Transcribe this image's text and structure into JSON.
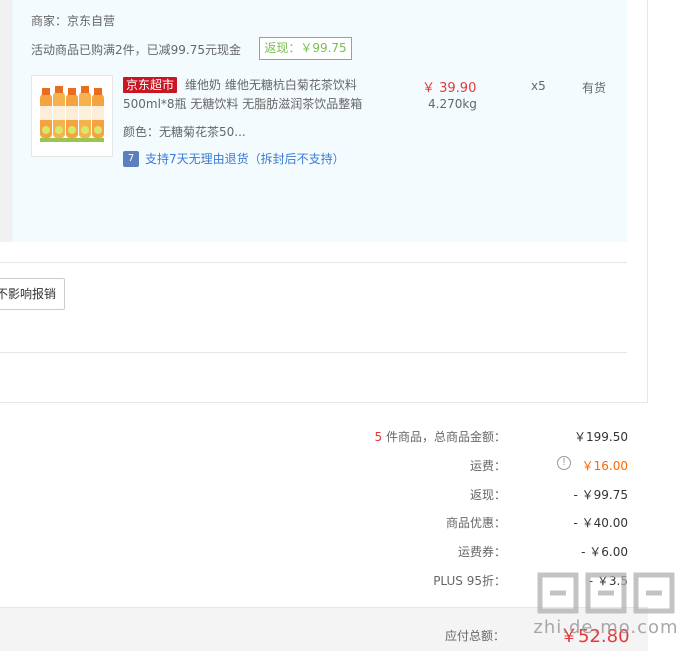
{
  "shop": {
    "seller": "商家：京东自营",
    "promo": "活动商品已购满2件，已减99.75元现金",
    "cashback_tag": "返现：￥99.75"
  },
  "item": {
    "tag": "京东超市",
    "title": "维他奶 维他无糖杭白菊花茶饮料500ml*8瓶 无糖饮料 无脂肪滋润茶饮品整箱",
    "color": "颜色：无糖菊花茶50...",
    "return_icon": "7",
    "return_text": "支持7天无理由退货（拆封后不支持）",
    "price": "￥ 39.90",
    "weight": "4.270kg",
    "qty": "x5",
    "stock": "有货",
    "thumb_icon": "product-bottles-icon"
  },
  "invoice_button": "不影响报销",
  "summary": {
    "count": "5",
    "count_label": " 件商品，总商品金额：",
    "total_value": "￥199.50",
    "shipping_label": "运费：",
    "shipping_info_icon": "!",
    "shipping_value": "￥16.00",
    "cashback_label": "返现：",
    "cashback_value": "- ￥99.75",
    "discount_label": "商品优惠：",
    "discount_value": "- ￥40.00",
    "coupon_label": "运费券：",
    "coupon_value": "- ￥6.00",
    "plus_label": "PLUS 95折：",
    "plus_value": "- ￥3.5",
    "pay_label": "应付总额：",
    "pay_value": "￥52.80"
  },
  "watermark": {
    "glyph": "值",
    "text": "zhi.de.mo.com"
  },
  "colors": {
    "accent_red": "#e4393c",
    "shipping_orange": "#ff6600",
    "cashback_green": "#7abd54",
    "link_blue": "#3a7bd5",
    "tag_red": "#c81623"
  }
}
